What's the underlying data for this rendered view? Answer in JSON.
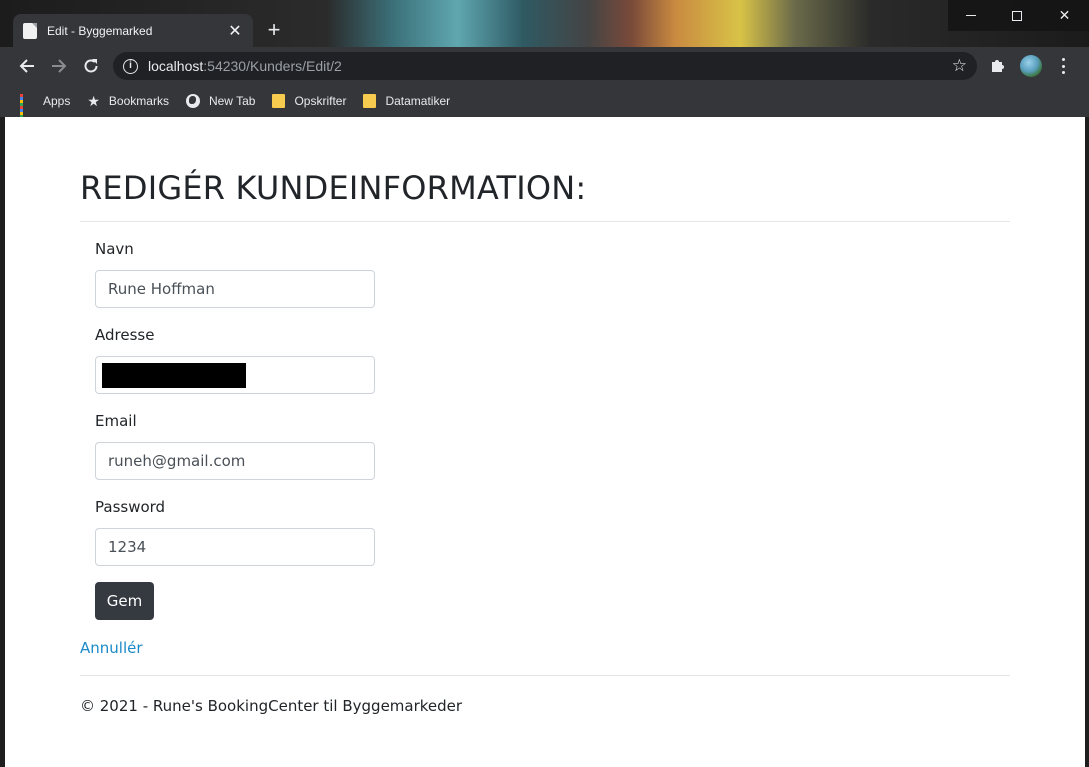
{
  "browser": {
    "tab_title": "Edit - Byggemarked",
    "tab_close": "✕",
    "new_tab": "+",
    "url_host": "localhost",
    "url_rest": ":54230/Kunders/Edit/2",
    "bookmarks": [
      {
        "label": "Apps",
        "icon": "apps-grid-icon"
      },
      {
        "label": "Bookmarks",
        "icon": "star-icon"
      },
      {
        "label": "New Tab",
        "icon": "globe-icon"
      },
      {
        "label": "Opskrifter",
        "icon": "folder-icon"
      },
      {
        "label": "Datamatiker",
        "icon": "folder-icon"
      }
    ]
  },
  "page": {
    "title": "REDIGÉR KUNDEINFORMATION:",
    "fields": {
      "navn": {
        "label": "Navn",
        "value": "Rune Hoffman"
      },
      "adresse": {
        "label": "Adresse",
        "value": ""
      },
      "email": {
        "label": "Email",
        "value": "runeh@gmail.com"
      },
      "password": {
        "label": "Password",
        "value": "1234"
      }
    },
    "save_label": "Gem",
    "cancel_label": "Annullér",
    "footer": "© 2021 - Rune's BookingCenter til Byggemarkeder"
  },
  "colors": {
    "button_bg": "#343a40",
    "link": "#1b8ac8",
    "text": "#212529"
  }
}
